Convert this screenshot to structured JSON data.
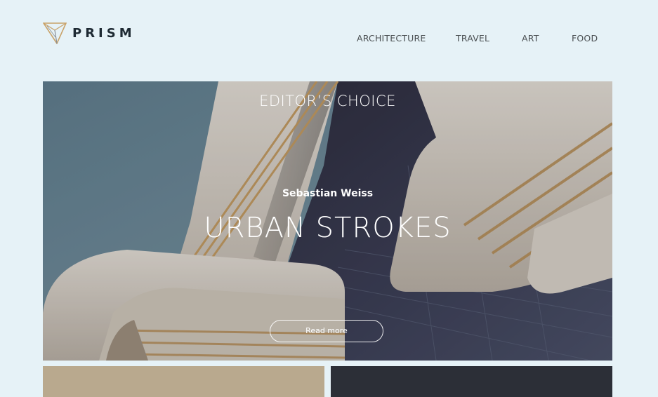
{
  "brand": {
    "name": "PRISM"
  },
  "nav": {
    "items": [
      {
        "label": "ARCHITECTURE"
      },
      {
        "label": "TRAVEL"
      },
      {
        "label": "ART"
      },
      {
        "label": "FOOD"
      }
    ]
  },
  "hero": {
    "label": "EDITOR’S CHOICE",
    "author": "Sebastian Weiss",
    "title": "URBAN STROKES",
    "button": "Read more"
  },
  "colors": {
    "background": "#e6f2f7",
    "card_left": "#b9a98e",
    "card_right": "#2c2f37",
    "text_dark": "#1e2a33",
    "nav_text": "#4a4f52"
  }
}
